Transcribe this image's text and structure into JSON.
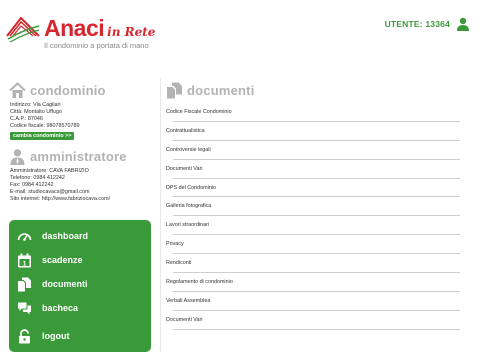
{
  "header": {
    "brand_name": "Anaci",
    "brand_suffix": "in Rete",
    "tagline": "Il condominio a portata di mano",
    "user_label": "UTENTE: 13364",
    "brand_color": "#d8262e",
    "accent_color": "#3a9a3a"
  },
  "condominio": {
    "title": "condominio",
    "icon": "house-icon",
    "indirizzo": "Indirizzo: Via Cagliari",
    "citta": "Città: Montalto Uffugo",
    "cap": "C.A.P.: 87046",
    "codice_fiscale": "Codice fiscale: 98078570789",
    "change_button": "cambia condominio >>"
  },
  "amministratore": {
    "title": "amministratore",
    "icon": "admin-user-icon",
    "nome": "Amministratore: CAVA FABRIZIO",
    "telefono": "Telefono: 0984 412242",
    "fax": "Fax: 0984 412242",
    "email": "E-mail: studiocavacs@gmail.com",
    "sito": "Sito internet: http://www.fabriziocava.com/"
  },
  "nav": {
    "items": [
      {
        "label": "dashboard",
        "icon": "gauge-icon"
      },
      {
        "label": "scadenze",
        "icon": "calendar-icon"
      },
      {
        "label": "documenti",
        "icon": "documents-icon"
      },
      {
        "label": "bacheca",
        "icon": "chat-bubbles-icon"
      },
      {
        "label": "logout",
        "icon": "padlock-icon"
      }
    ]
  },
  "documenti": {
    "title": "documenti",
    "icon": "documents-icon",
    "items": [
      "Codice Fiscale Condominio",
      "Contrattualistica",
      "Controversie legali",
      "Documenti Vari",
      "DPS del Condominio",
      "Galleria fotografica",
      "Lavori straordinari",
      "Privacy",
      "Rendiconti",
      "Regolamento di condominio",
      "Verbali Assemblea",
      "Documenti Vari"
    ]
  }
}
